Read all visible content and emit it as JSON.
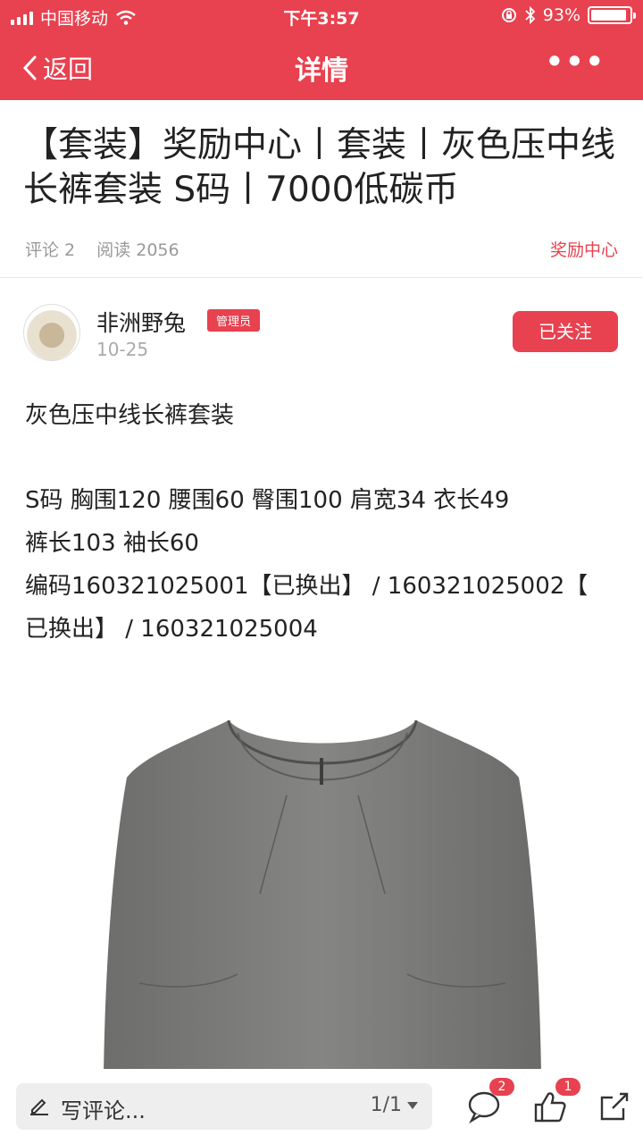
{
  "status_bar": {
    "carrier": "中国移动",
    "time": "下午3:57",
    "battery_text": "93%",
    "battery_level": 0.93
  },
  "nav": {
    "back_label": "返回",
    "title": "详情",
    "more_label": "•••"
  },
  "article": {
    "title": "【套装】奖励中心丨套装丨灰色压中线长裤套装 S码丨7000低碳币",
    "comments": "评论 2",
    "reads": "阅读 2056",
    "category": "奖励中心"
  },
  "author": {
    "name": "非洲野兔",
    "badge": "管理员",
    "date": "10-25",
    "follow_label": "已关注"
  },
  "content": {
    "intro": "灰色压中线长裤套装",
    "line1": "S码 胸围120  腰围60  臀围100  肩宽34  衣长49",
    "line2": "裤长103  袖长60",
    "line3": "编码160321025001【已换出】 / 160321025002【",
    "line4": "已换出】 / 160321025004"
  },
  "bottom_bar": {
    "comment_placeholder": "写评论...",
    "page_indicator": "1/1",
    "comment_count": "2",
    "like_count": "1"
  },
  "colors": {
    "accent": "#e8414f",
    "meta_gray": "#999999"
  }
}
